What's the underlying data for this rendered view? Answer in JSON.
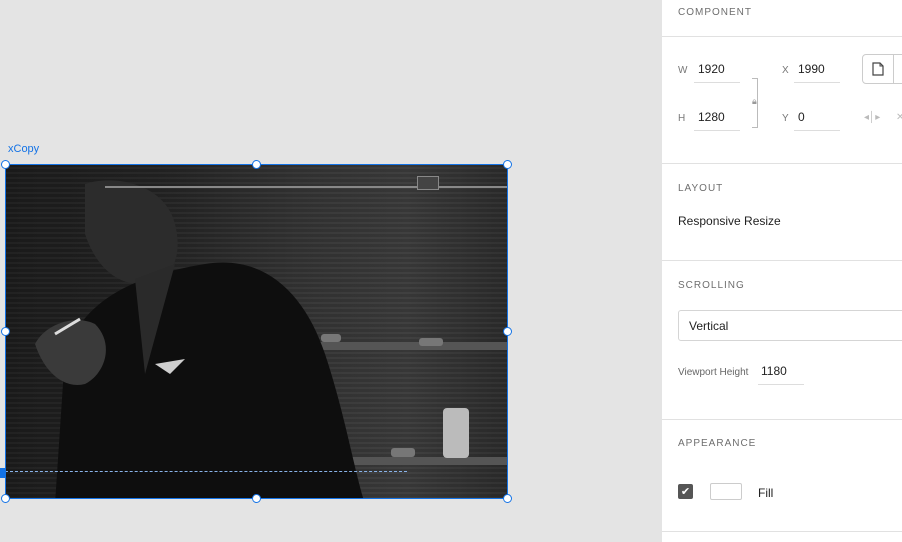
{
  "canvas": {
    "artboard_label": "xCopy"
  },
  "panel": {
    "component": {
      "title": "COMPONENT",
      "w_label": "W",
      "w_value": "1920",
      "x_label": "X",
      "x_value": "1990",
      "h_label": "H",
      "h_value": "1280",
      "y_label": "Y",
      "y_value": "0"
    },
    "layout": {
      "title": "LAYOUT",
      "value": "Responsive Resize"
    },
    "scrolling": {
      "title": "SCROLLING",
      "selected": "Vertical",
      "viewport_label": "Viewport Height",
      "viewport_value": "1180"
    },
    "appearance": {
      "title": "APPEARANCE",
      "fill_label": "Fill",
      "fill_checked": true,
      "fill_color": "#ffffff"
    }
  },
  "colors": {
    "selection": "#1473e6",
    "panel_bg": "#ffffff",
    "canvas_bg": "#e4e4e4"
  },
  "icons": [
    "lock-icon",
    "document-icon",
    "flip-horizontal-icon",
    "flip-vertical-icon",
    "checkmark-icon"
  ]
}
